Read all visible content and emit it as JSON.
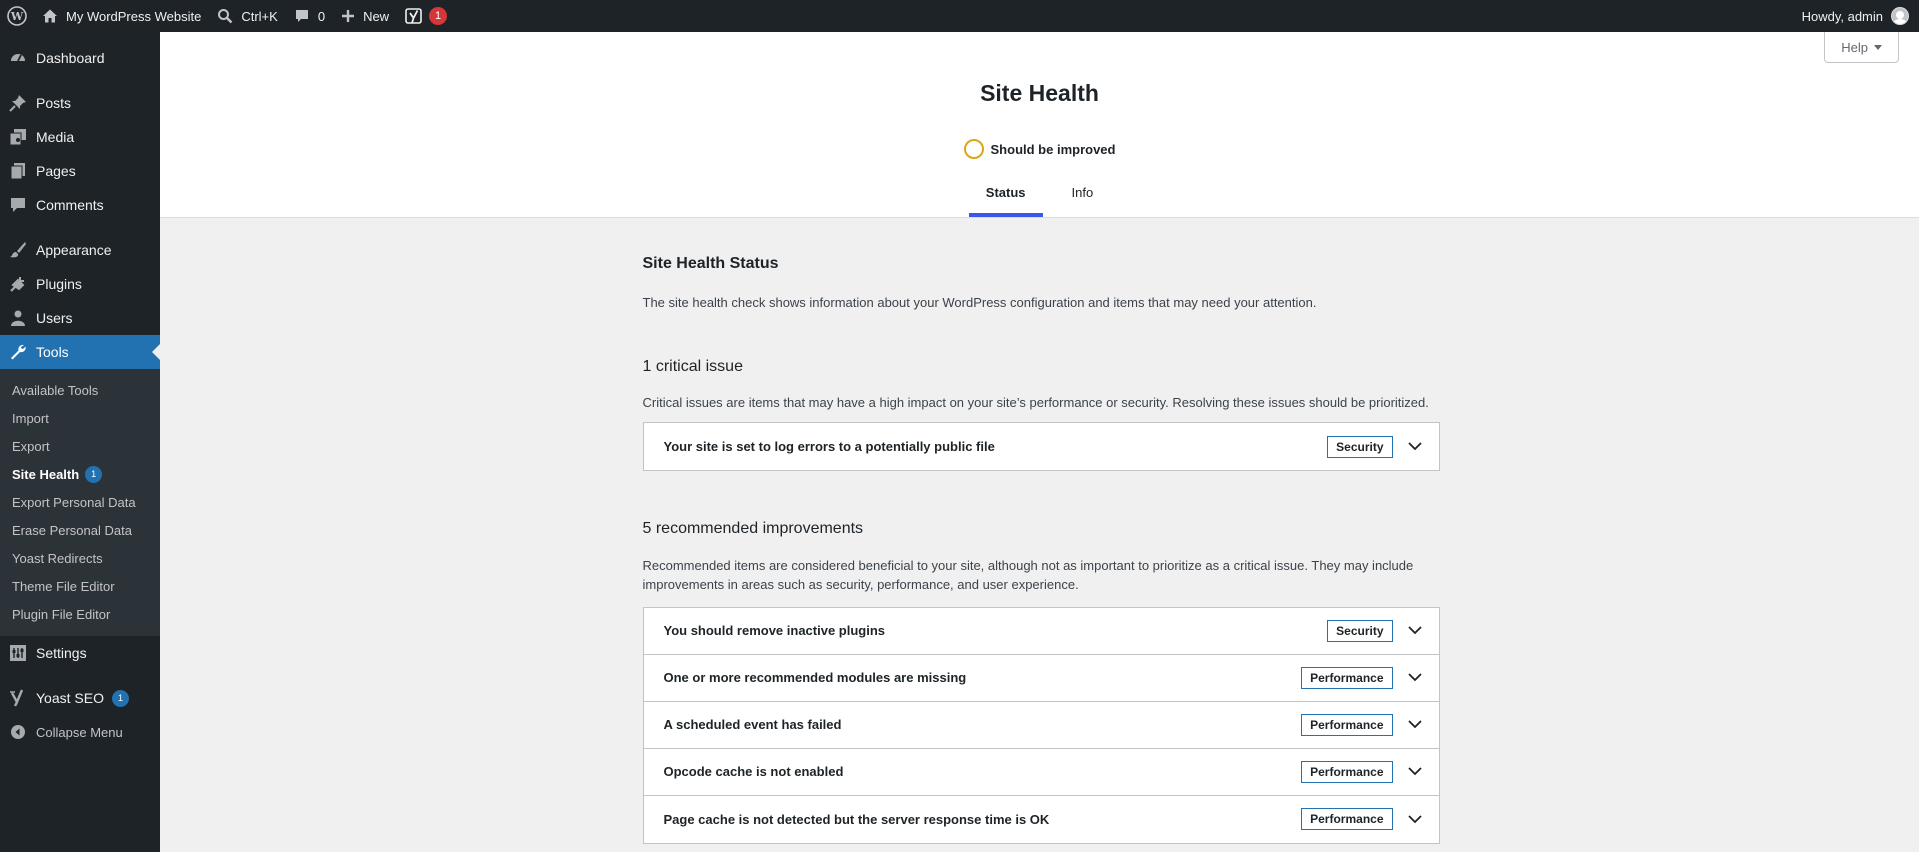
{
  "admin_bar": {
    "site_name": "My WordPress Website",
    "search_shortcut": "Ctrl+K",
    "comments_count": "0",
    "new_label": "New",
    "yoast_count": "1",
    "greeting": "Howdy, admin"
  },
  "sidebar": {
    "items": [
      {
        "label": "Dashboard",
        "icon": "dashboard-icon"
      },
      {
        "label": "Posts",
        "icon": "pin-icon"
      },
      {
        "label": "Media",
        "icon": "media-icon"
      },
      {
        "label": "Pages",
        "icon": "pages-icon"
      },
      {
        "label": "Comments",
        "icon": "comment-icon"
      },
      {
        "label": "Appearance",
        "icon": "brush-icon"
      },
      {
        "label": "Plugins",
        "icon": "plug-icon"
      },
      {
        "label": "Users",
        "icon": "user-icon"
      },
      {
        "label": "Tools",
        "icon": "wrench-icon"
      },
      {
        "label": "Settings",
        "icon": "sliders-icon"
      },
      {
        "label": "Yoast SEO",
        "icon": "yoast-icon",
        "count": "1"
      },
      {
        "label": "Collapse Menu",
        "icon": "collapse-icon"
      }
    ],
    "tools_submenu": [
      {
        "label": "Available Tools"
      },
      {
        "label": "Import"
      },
      {
        "label": "Export"
      },
      {
        "label": "Site Health",
        "count": "1"
      },
      {
        "label": "Export Personal Data"
      },
      {
        "label": "Erase Personal Data"
      },
      {
        "label": "Yoast Redirects"
      },
      {
        "label": "Theme File Editor"
      },
      {
        "label": "Plugin File Editor"
      }
    ]
  },
  "header": {
    "help_label": "Help",
    "title": "Site Health",
    "status_label": "Should be improved",
    "tabs": [
      {
        "label": "Status"
      },
      {
        "label": "Info"
      }
    ]
  },
  "main": {
    "status_title": "Site Health Status",
    "status_desc": "The site health check shows information about your WordPress configuration and items that may need your attention.",
    "critical_heading": "1 critical issue",
    "critical_desc": "Critical issues are items that may have a high impact on your site’s performance or security. Resolving these issues should be prioritized.",
    "critical_issues": [
      {
        "label": "Your site is set to log errors to a potentially public file",
        "badge": "Security"
      }
    ],
    "recommended_heading": "5 recommended improvements",
    "recommended_desc_line1": "Recommended items are considered beneficial to your site, although not as important to prioritize as a critical issue. They may include",
    "recommended_desc_line2": "improvements in areas such as security, performance, and user experience.",
    "recommended_issues": [
      {
        "label": "You should remove inactive plugins",
        "badge": "Security"
      },
      {
        "label": "One or more recommended modules are missing",
        "badge": "Performance"
      },
      {
        "label": "A scheduled event has failed",
        "badge": "Performance"
      },
      {
        "label": "Opcode cache is not enabled",
        "badge": "Performance"
      },
      {
        "label": "Page cache is not detected but the server response time is OK",
        "badge": "Performance"
      }
    ]
  },
  "colors": {
    "adminbar_bg": "#1d2327",
    "accent": "#2271b1",
    "tab_active": "#3858e9",
    "status_ring": "#dba617",
    "notice_red": "#d63638"
  }
}
